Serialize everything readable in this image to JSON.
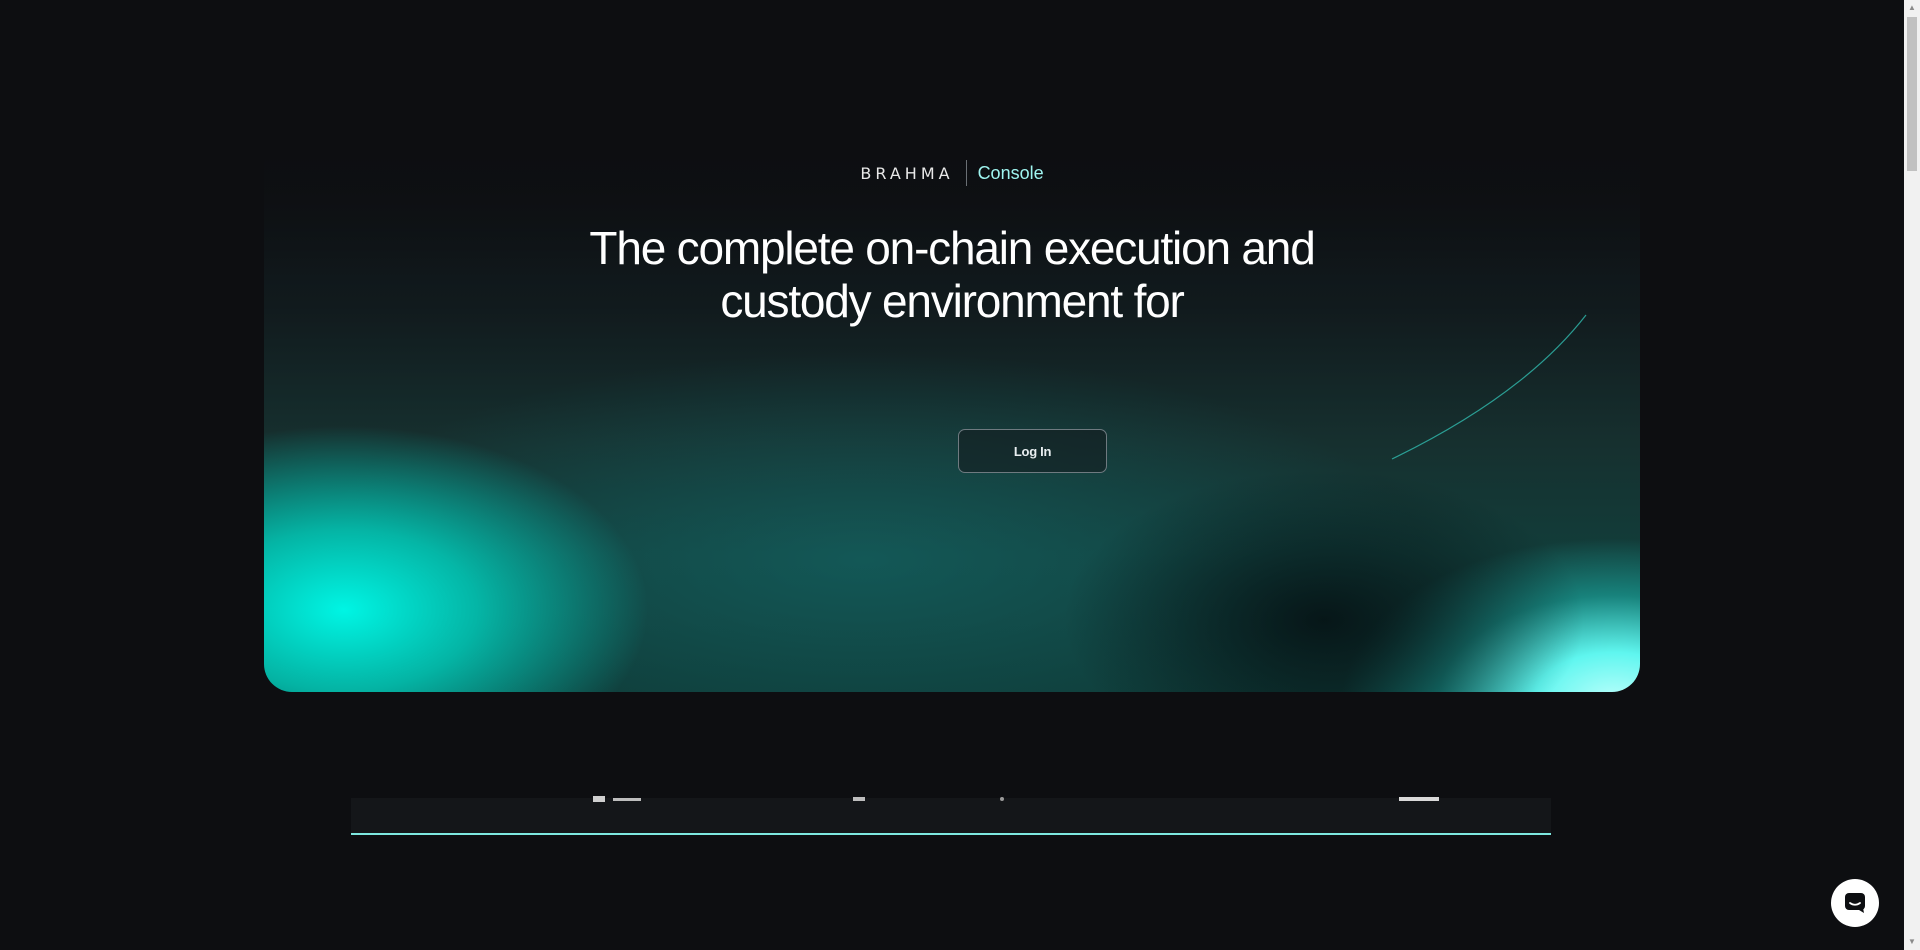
{
  "brand": {
    "logo": "BRAHMA",
    "product": "Console"
  },
  "hero": {
    "headline_line1": "The complete on-chain execution and",
    "headline_line2": "custody environment for",
    "login_label": "Log In"
  },
  "colors": {
    "background": "#0d0e11",
    "accent": "#00f5e4",
    "console_text": "#9ff5f0",
    "strip_underline": "#7ee8e0"
  },
  "icons": {
    "chat": "chat-bubble-icon"
  }
}
